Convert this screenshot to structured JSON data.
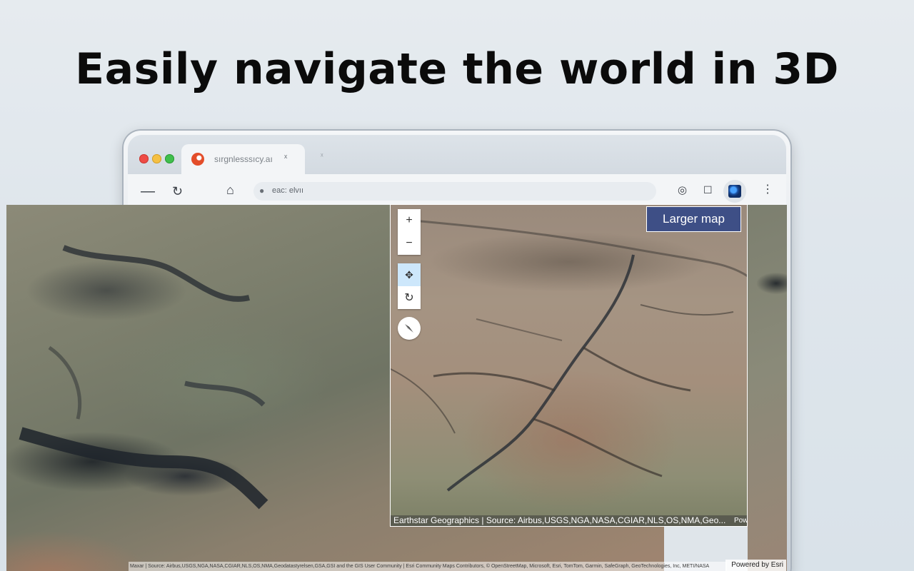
{
  "headline": "Easily navigate the world in 3D",
  "browser": {
    "tab_title": "sırgnlesssıcy.aı",
    "tab_close": "ˣ",
    "new_tab": "ˣ",
    "address": "eac: elvıı"
  },
  "map": {
    "larger_map_label": "Larger map",
    "zoom_in": "+",
    "zoom_out": "−",
    "attribution": "Earthstar Geographics | Source: Airbus,USGS,NGA,NASA,CGIAR,NLS,OS,NMA,Geo...",
    "powered_short": "Pow",
    "bg_attribution": "Maxar | Source: Airbus,USGS,NGA,NASA,CGIAR,NLS,OS,NMA,Geodatastyrelsen,GSA,GSI and the GIS User Community | Esri Community Maps Contributors, © OpenStreetMap, Microsoft, Esri, TomTom, Garmin, SafeGraph, GeoTechnologies, Inc, METI/NASA",
    "powered_by": "Powered by Esri"
  },
  "icons": {
    "back": "minus-icon",
    "reload": "reload-icon",
    "home": "home-icon",
    "globe": "globe-extension-icon",
    "pan": "pan-icon",
    "rotate": "rotate-icon",
    "compass": "compass-icon"
  },
  "colors": {
    "larger_map_bg": "#3e4f86",
    "pan_active": "#cde7fb"
  }
}
